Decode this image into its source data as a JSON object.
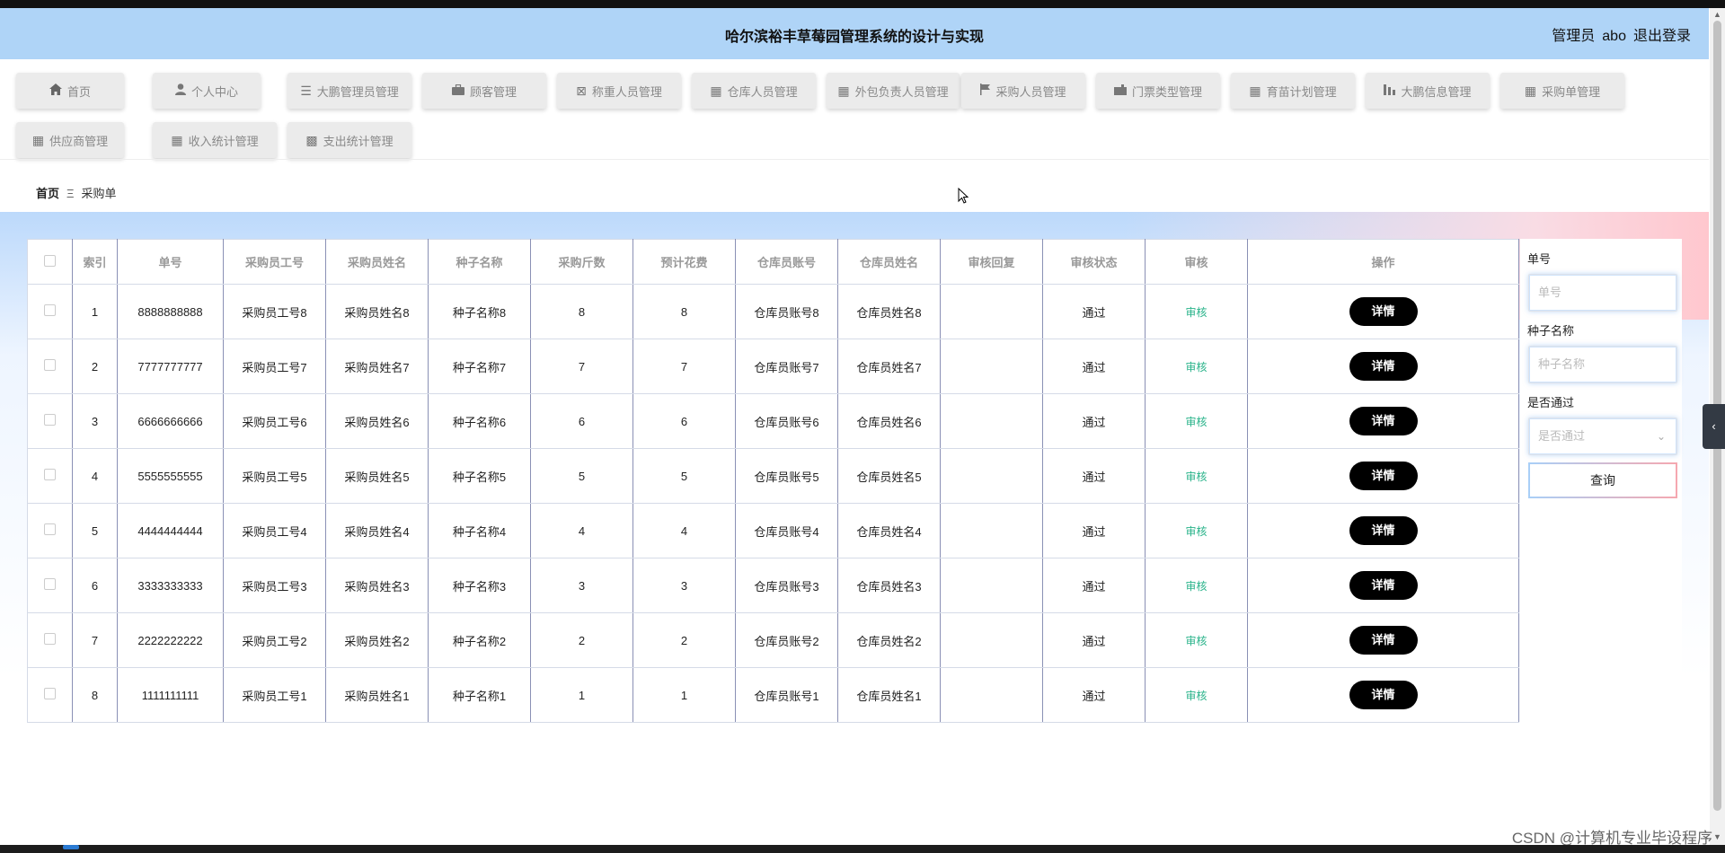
{
  "header": {
    "title": "哈尔滨裕丰草莓园管理系统的设计与实现",
    "role": "管理员",
    "username": "abo",
    "logout": "退出登录"
  },
  "nav": [
    {
      "label": "首页",
      "icon": "home-icon"
    },
    {
      "label": "个人中心",
      "icon": "user-icon"
    },
    {
      "label": "大鹏管理员管理",
      "icon": "list-icon"
    },
    {
      "label": "顾客管理",
      "icon": "briefcase-icon"
    },
    {
      "label": "称重人员管理",
      "icon": "square-x-icon"
    },
    {
      "label": "仓库人员管理",
      "icon": "grid-icon"
    },
    {
      "label": "外包负责人员管理",
      "icon": "grid-icon"
    },
    {
      "label": "采购人员管理",
      "icon": "flag-icon"
    },
    {
      "label": "门票类型管理",
      "icon": "ticket-icon"
    },
    {
      "label": "育苗计划管理",
      "icon": "grid-icon"
    },
    {
      "label": "大鹏信息管理",
      "icon": "bar-chart-icon"
    },
    {
      "label": "采购单管理",
      "icon": "grid-icon"
    },
    {
      "label": "供应商管理",
      "icon": "grid-icon"
    },
    {
      "label": "收入统计管理",
      "icon": "grid-icon"
    },
    {
      "label": "支出统计管理",
      "icon": "apps-icon"
    }
  ],
  "breadcrumb": {
    "home": "首页",
    "separator": "Ξ",
    "current": "采购单"
  },
  "table": {
    "columns": [
      "索引",
      "单号",
      "采购员工号",
      "采购员姓名",
      "种子名称",
      "采购斤数",
      "预计花费",
      "仓库员账号",
      "仓库员姓名",
      "审核回复",
      "审核状态",
      "审核",
      "操作"
    ],
    "rows": [
      {
        "index": "1",
        "no": "8888888888",
        "staff_id": "采购员工号8",
        "staff_name": "采购员姓名8",
        "seed": "种子名称8",
        "jin": "8",
        "cost": "8",
        "wh_account": "仓库员账号8",
        "wh_name": "仓库员姓名8",
        "reply": "",
        "status": "通过",
        "audit": "审核",
        "action": "详情"
      },
      {
        "index": "2",
        "no": "7777777777",
        "staff_id": "采购员工号7",
        "staff_name": "采购员姓名7",
        "seed": "种子名称7",
        "jin": "7",
        "cost": "7",
        "wh_account": "仓库员账号7",
        "wh_name": "仓库员姓名7",
        "reply": "",
        "status": "通过",
        "audit": "审核",
        "action": "详情"
      },
      {
        "index": "3",
        "no": "6666666666",
        "staff_id": "采购员工号6",
        "staff_name": "采购员姓名6",
        "seed": "种子名称6",
        "jin": "6",
        "cost": "6",
        "wh_account": "仓库员账号6",
        "wh_name": "仓库员姓名6",
        "reply": "",
        "status": "通过",
        "audit": "审核",
        "action": "详情"
      },
      {
        "index": "4",
        "no": "5555555555",
        "staff_id": "采购员工号5",
        "staff_name": "采购员姓名5",
        "seed": "种子名称5",
        "jin": "5",
        "cost": "5",
        "wh_account": "仓库员账号5",
        "wh_name": "仓库员姓名5",
        "reply": "",
        "status": "通过",
        "audit": "审核",
        "action": "详情"
      },
      {
        "index": "5",
        "no": "4444444444",
        "staff_id": "采购员工号4",
        "staff_name": "采购员姓名4",
        "seed": "种子名称4",
        "jin": "4",
        "cost": "4",
        "wh_account": "仓库员账号4",
        "wh_name": "仓库员姓名4",
        "reply": "",
        "status": "通过",
        "audit": "审核",
        "action": "详情"
      },
      {
        "index": "6",
        "no": "3333333333",
        "staff_id": "采购员工号3",
        "staff_name": "采购员姓名3",
        "seed": "种子名称3",
        "jin": "3",
        "cost": "3",
        "wh_account": "仓库员账号3",
        "wh_name": "仓库员姓名3",
        "reply": "",
        "status": "通过",
        "audit": "审核",
        "action": "详情"
      },
      {
        "index": "7",
        "no": "2222222222",
        "staff_id": "采购员工号2",
        "staff_name": "采购员姓名2",
        "seed": "种子名称2",
        "jin": "2",
        "cost": "2",
        "wh_account": "仓库员账号2",
        "wh_name": "仓库员姓名2",
        "reply": "",
        "status": "通过",
        "audit": "审核",
        "action": "详情"
      },
      {
        "index": "8",
        "no": "1111111111",
        "staff_id": "采购员工号1",
        "staff_name": "采购员姓名1",
        "seed": "种子名称1",
        "jin": "1",
        "cost": "1",
        "wh_account": "仓库员账号1",
        "wh_name": "仓库员姓名1",
        "reply": "",
        "status": "通过",
        "audit": "审核",
        "action": "详情"
      }
    ]
  },
  "search": {
    "no_label": "单号",
    "no_placeholder": "单号",
    "seed_label": "种子名称",
    "seed_placeholder": "种子名称",
    "pass_label": "是否通过",
    "pass_placeholder": "是否通过",
    "query_button": "查询"
  },
  "watermark": "CSDN @计算机专业毕设程序",
  "colors": {
    "header_bg": "#afd4f7",
    "audit_text": "#29b38a",
    "detail_button": "#000000"
  }
}
